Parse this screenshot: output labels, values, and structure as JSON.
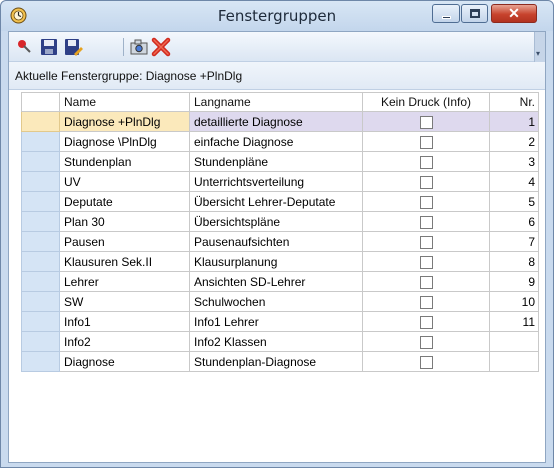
{
  "window": {
    "title": "Fenstergruppen"
  },
  "toolbar": {
    "icons": [
      "pin-icon",
      "save-icon",
      "save-as-icon",
      "camera-icon",
      "delete-icon"
    ]
  },
  "group": {
    "label": "Aktuelle Fenstergruppe: Diagnose +PlnDlg"
  },
  "table": {
    "headers": {
      "name": "Name",
      "langname": "Langname",
      "kein_druck": "Kein Druck (Info)",
      "nr": "Nr."
    },
    "rows": [
      {
        "name": "Diagnose +PlnDlg",
        "langname": "detaillierte Diagnose",
        "kein_druck": false,
        "nr": "1"
      },
      {
        "name": "Diagnose \\PlnDlg",
        "langname": "einfache Diagnose",
        "kein_druck": false,
        "nr": "2"
      },
      {
        "name": "Stundenplan",
        "langname": "Stundenpläne",
        "kein_druck": false,
        "nr": "3"
      },
      {
        "name": "UV",
        "langname": "Unterrichtsverteilung",
        "kein_druck": false,
        "nr": "4"
      },
      {
        "name": "Deputate",
        "langname": "Übersicht Lehrer-Deputate",
        "kein_druck": false,
        "nr": "5"
      },
      {
        "name": "Plan 30",
        "langname": "Übersichtspläne",
        "kein_druck": false,
        "nr": "6"
      },
      {
        "name": "Pausen",
        "langname": "Pausenaufsichten",
        "kein_druck": false,
        "nr": "7"
      },
      {
        "name": "Klausuren Sek.II",
        "langname": "Klausurplanung",
        "kein_druck": false,
        "nr": "8"
      },
      {
        "name": "Lehrer",
        "langname": "Ansichten SD-Lehrer",
        "kein_druck": false,
        "nr": "9"
      },
      {
        "name": "SW",
        "langname": "Schulwochen",
        "kein_druck": false,
        "nr": "10"
      },
      {
        "name": "Info1",
        "langname": "Info1 Lehrer",
        "kein_druck": false,
        "nr": "11"
      },
      {
        "name": "Info2",
        "langname": "Info2 Klassen",
        "kein_druck": false,
        "nr": ""
      },
      {
        "name": "Diagnose",
        "langname": "Stundenplan-Diagnose",
        "kein_druck": false,
        "nr": ""
      }
    ]
  }
}
